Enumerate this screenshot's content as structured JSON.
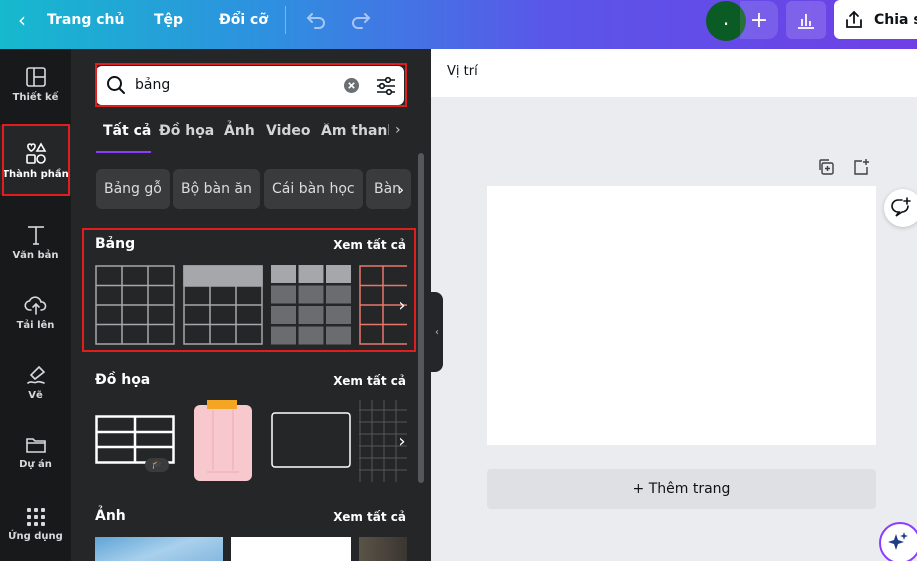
{
  "topbar": {
    "home_label": "Trang chủ",
    "file_label": "Tệp",
    "resize_label": "Đổi cỡ",
    "avatar_initial": ".",
    "share_label": "Chia sẻ"
  },
  "rail": {
    "items": [
      {
        "label": "Thiết kế",
        "icon": "layout-icon"
      },
      {
        "label": "Thành phần",
        "icon": "elements-icon"
      },
      {
        "label": "Văn bản",
        "icon": "text-icon"
      },
      {
        "label": "Tải lên",
        "icon": "upload-cloud-icon"
      },
      {
        "label": "Vẽ",
        "icon": "draw-pen-icon"
      },
      {
        "label": "Dự án",
        "icon": "folder-icon"
      },
      {
        "label": "Ứng dụng",
        "icon": "apps-grid-icon"
      }
    ]
  },
  "panel": {
    "search_value": "bảng",
    "tabs": [
      "Tất cả",
      "Đồ họa",
      "Ảnh",
      "Video",
      "Âm thanh"
    ],
    "chips": [
      "Bảng gỗ",
      "Bộ bàn ăn",
      "Cái bàn học",
      "Bàn"
    ],
    "sections": {
      "tables": {
        "title": "Bảng",
        "see_all": "Xem tất cả"
      },
      "graphics": {
        "title": "Đồ họa",
        "see_all": "Xem tất cả"
      },
      "photos": {
        "title": "Ảnh",
        "see_all": "Xem tất cả"
      }
    }
  },
  "canvas": {
    "position_label": "Vị trí",
    "add_page_label": "+ Thêm trang"
  },
  "colors": {
    "accent": "#8b3dff",
    "highlight": "#e01e1e",
    "panel_bg": "#252627",
    "rail_bg": "#18191b"
  }
}
